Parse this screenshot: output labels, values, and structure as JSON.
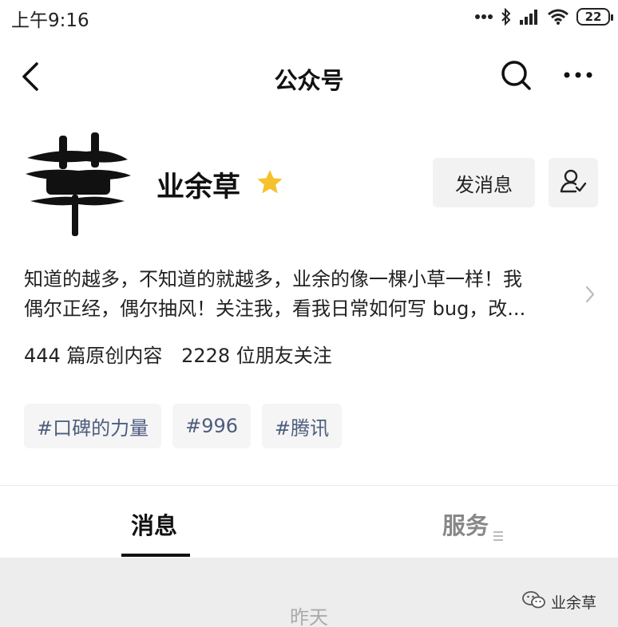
{
  "status_bar": {
    "time": "上午9:16",
    "battery": "22",
    "icons": [
      "dots-icon",
      "bluetooth-icon",
      "signal-icon",
      "wifi-icon",
      "battery-icon"
    ]
  },
  "nav": {
    "title": "公众号",
    "icons": [
      "back-icon",
      "search-icon",
      "more-icon"
    ]
  },
  "profile": {
    "avatar_glyph": "草",
    "name": "业余草",
    "star_color": "#f7c12e",
    "message_button": "发消息",
    "description_lines": [
      "知道的越多，不知道的就越多，业余的像一棵小草一样！我",
      "偶尔正经，偶尔抽风！关注我，看我日常如何写 bug，改..."
    ],
    "stats": {
      "original_articles": "444 篇原创内容",
      "followers": "2228 位朋友关注"
    }
  },
  "tags": [
    "#口碑的力量",
    "#996",
    "#腾讯"
  ],
  "tabs": {
    "messages": "消息",
    "services": "服务"
  },
  "feed": {
    "date": "昨天"
  },
  "watermark": {
    "text": "业余草"
  },
  "colors": {
    "tag_text": "#4d5d7e",
    "button_bg": "#f2f2f2",
    "feed_bg": "#ededed"
  }
}
